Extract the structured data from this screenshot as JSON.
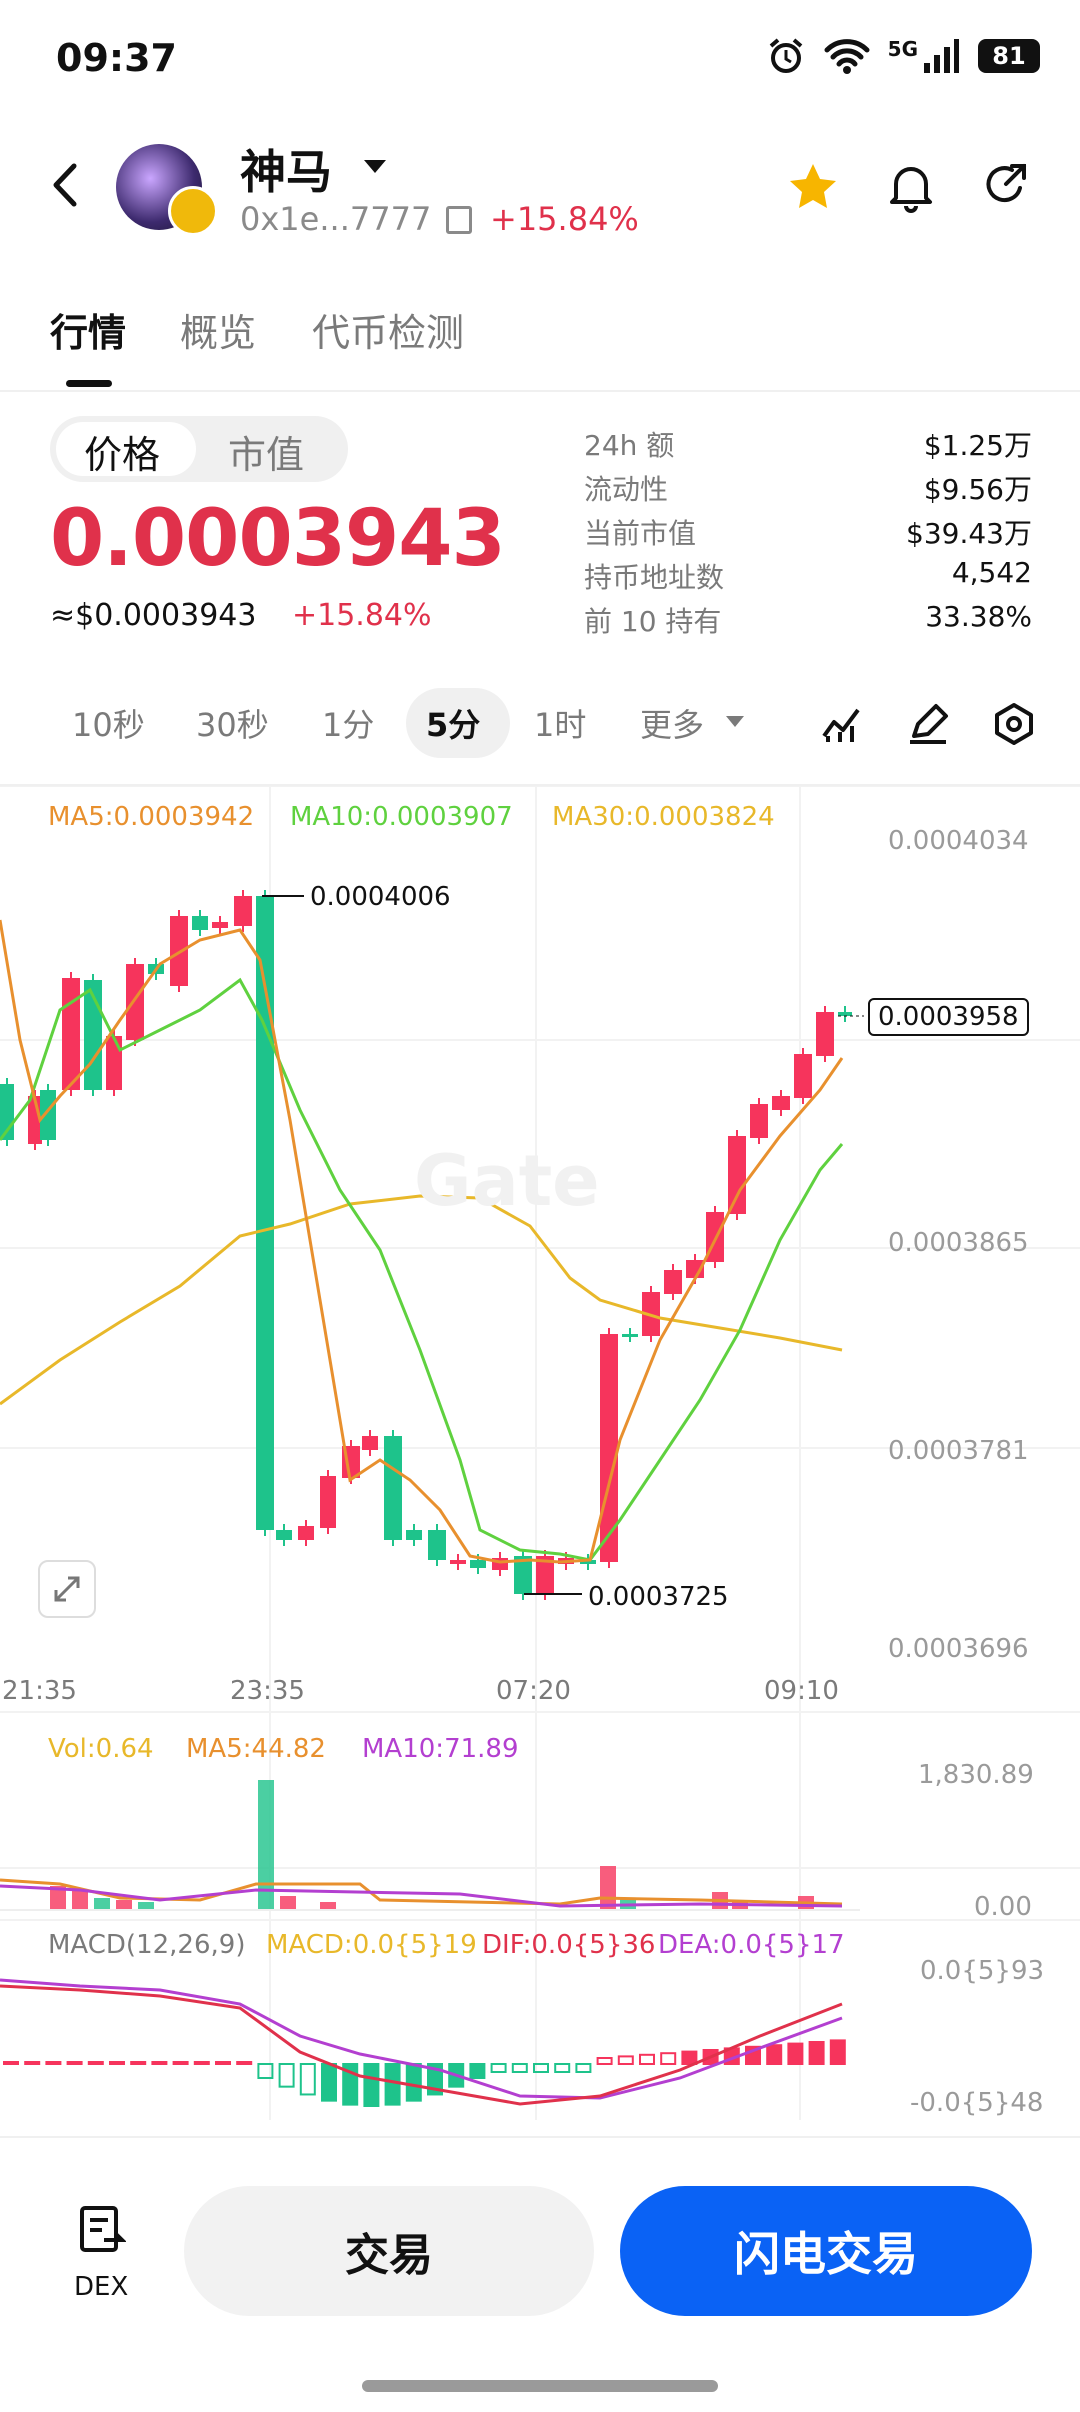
{
  "status_bar": {
    "time": "09:37",
    "network": "5G",
    "battery": "81"
  },
  "header": {
    "token_name": "神马",
    "address": "0x1e...7777",
    "change": "+15.84%"
  },
  "tabs": [
    {
      "label": "行情",
      "active": true
    },
    {
      "label": "概览",
      "active": false
    },
    {
      "label": "代币检测",
      "active": false
    }
  ],
  "price_panel": {
    "toggle": [
      "价格",
      "市值"
    ],
    "price": "0.0003943",
    "usd_price": "≈$0.0003943",
    "change": "+15.84%"
  },
  "stats": [
    {
      "label": "24h  额",
      "value": "$1.25万"
    },
    {
      "label": "流动性",
      "value": "$9.56万"
    },
    {
      "label": "当前市值",
      "value": "$39.43万"
    },
    {
      "label": "持币地址数",
      "value": "4,542"
    },
    {
      "label": "前 10 持有",
      "value": "33.38%"
    }
  ],
  "intervals": [
    {
      "label": "10秒",
      "active": false
    },
    {
      "label": "30秒",
      "active": false
    },
    {
      "label": "1分",
      "active": false
    },
    {
      "label": "5分",
      "active": true
    },
    {
      "label": "1时",
      "active": false
    },
    {
      "label": "更多",
      "active": false
    }
  ],
  "chart": {
    "ma_labels": [
      {
        "text": "MA5:0.0003942",
        "color": "#e8902e"
      },
      {
        "text": "MA10:0.0003907",
        "color": "#5fd13f"
      },
      {
        "text": "MA30:0.0003824",
        "color": "#e8b82a"
      }
    ],
    "y_axis": [
      "0.0004034",
      "0.0003865",
      "0.0003781",
      "0.0003696"
    ],
    "last_price_tag": "0.0003958",
    "high_label": "0.0004006",
    "low_label": "0.0003725",
    "x_axis": [
      "21:35",
      "23:35",
      "07:20",
      "09:10"
    ],
    "watermark": "Gate",
    "colors": {
      "up": "#f6345c",
      "down": "#1ec38b",
      "ma5": "#e8902e",
      "ma10": "#5fd13f",
      "ma30": "#e8b82a"
    }
  },
  "volume": {
    "labels": [
      {
        "text": "Vol:0.64",
        "color": "#e8b82a"
      },
      {
        "text": "MA5:44.82",
        "color": "#e8902e"
      },
      {
        "text": "MA10:71.89",
        "color": "#b33fd0"
      }
    ],
    "y_axis": [
      "1,830.89",
      "0.00"
    ]
  },
  "macd": {
    "labels": [
      {
        "text": "MACD(12,26,9)",
        "color": "#7a7a7a"
      },
      {
        "text": "MACD:0.0{5}19",
        "color": "#e8b82a"
      },
      {
        "text": "DIF:0.0{5}36",
        "color": "#e0314b"
      },
      {
        "text": "DEA:0.0{5}17",
        "color": "#b33fd0"
      }
    ],
    "y_axis": [
      "0.0{5}93",
      "-0.0{5}48"
    ]
  },
  "bottom_bar": {
    "dex_label": "DEX",
    "trade_label": "交易",
    "flash_label": "闪电交易"
  }
}
